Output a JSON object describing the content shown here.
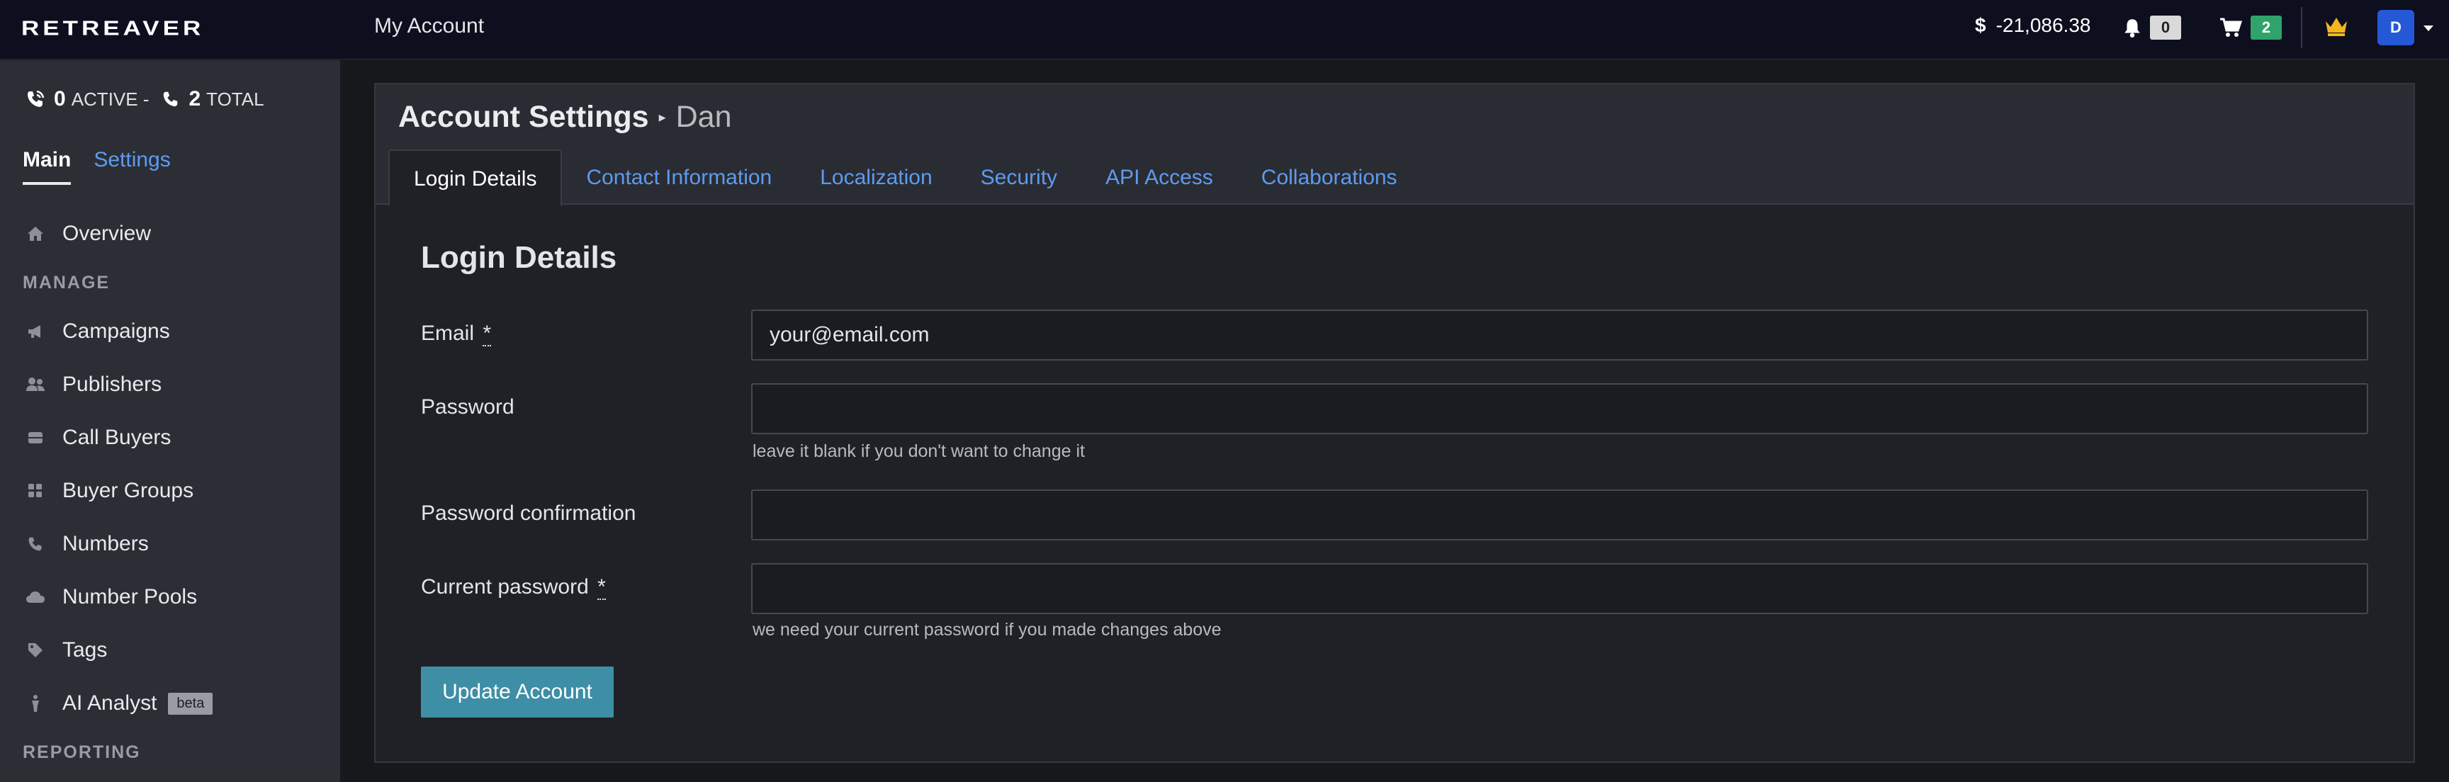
{
  "topbar": {
    "logo": "RETREAVER",
    "title": "My Account",
    "balance_symbol": "$",
    "balance": "-21,086.38",
    "notifications_count": "0",
    "cart_count": "2",
    "avatar_initial": "D"
  },
  "sidebar": {
    "active_calls": "0",
    "active_label": "ACTIVE -",
    "total_calls": "2",
    "total_label": "TOTAL",
    "tabs": [
      "Main",
      "Settings"
    ],
    "overview": "Overview",
    "manage_label": "MANAGE",
    "items": [
      "Campaigns",
      "Publishers",
      "Call Buyers",
      "Buyer Groups",
      "Numbers",
      "Number Pools",
      "Tags",
      "AI Analyst"
    ],
    "beta_label": "beta",
    "reporting_label": "REPORTING"
  },
  "main": {
    "page_title": "Account Settings",
    "user_name": "Dan",
    "tabs": [
      "Login Details",
      "Contact Information",
      "Localization",
      "Security",
      "API Access",
      "Collaborations"
    ],
    "form_title": "Login Details",
    "fields": {
      "email_label": "Email",
      "email_value": "your@email.com",
      "password_label": "Password",
      "password_hint": "leave it blank if you don't want to change it",
      "confirm_label": "Password confirmation",
      "current_label": "Current password",
      "current_hint": "we need your current password if you made changes above",
      "required_marker": "*"
    },
    "submit_label": "Update Account"
  },
  "colors": {
    "topbar_bg": "#0d0f1f",
    "sidebar_bg": "#2c2e35",
    "link": "#5c9cf2",
    "primary_button": "#3e8ea6",
    "avatar": "#2458d6",
    "cart_badge": "#2fa36b",
    "crown": "#f3b61f"
  },
  "icons": {
    "calls_active": "phone-volume-icon",
    "calls_total": "phone-icon",
    "overview": "home-icon",
    "campaigns": "megaphone-icon",
    "publishers": "users-icon",
    "call_buyers": "inbox-icon",
    "buyer_groups": "grid-icon",
    "numbers": "phone-icon",
    "number_pools": "cloud-icon",
    "tags": "tag-icon",
    "ai_analyst": "person-icon",
    "notifications": "bell-icon",
    "cart": "cart-icon",
    "premium": "crown-icon"
  }
}
